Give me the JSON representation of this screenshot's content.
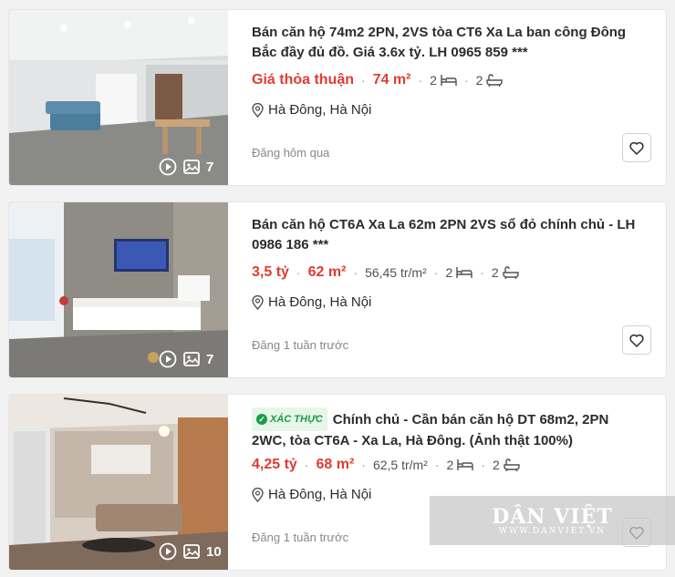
{
  "listings": [
    {
      "title": "Bán căn hộ 74m2 2PN, 2VS tòa CT6 Xa La ban công Đông Bắc đầy đủ đồ. Giá 3.6x tỷ. LH 0965 859 ***",
      "verified": false,
      "badge": "",
      "price": "Giá thỏa thuận",
      "area": "74 m²",
      "price_per_m2": "",
      "bedrooms": "2",
      "bathrooms": "2",
      "location": "Hà Đông, Hà Nội",
      "posted": "Đăng hôm qua",
      "photo_count": "7"
    },
    {
      "title": "Bán căn hộ CT6A Xa La 62m 2PN 2VS sổ đỏ chính chủ - LH 0986 186 ***",
      "verified": false,
      "badge": "",
      "price": "3,5 tỷ",
      "area": "62 m²",
      "price_per_m2": "56,45 tr/m²",
      "bedrooms": "2",
      "bathrooms": "2",
      "location": "Hà Đông, Hà Nội",
      "posted": "Đăng 1 tuần trước",
      "photo_count": "7"
    },
    {
      "title": "Chính chủ - Cần bán căn hộ DT 68m2, 2PN 2WC, tòa CT6A - Xa La, Hà Đông. (Ảnh thật 100%)",
      "verified": true,
      "badge": "XÁC THỰC",
      "price": "4,25 tỷ",
      "area": "68 m²",
      "price_per_m2": "62,5 tr/m²",
      "bedrooms": "2",
      "bathrooms": "2",
      "location": "Hà Đông, Hà Nội",
      "posted": "Đăng 1 tuần trước",
      "photo_count": "10"
    }
  ],
  "watermark": {
    "logo": "DÂN VIỆT",
    "url": "WWW.DANVIET.VN"
  },
  "colors": {
    "price": "#e03c31",
    "verified": "#1e9b46"
  },
  "icons": [
    "play-icon",
    "image-icon",
    "bed-icon",
    "bath-icon",
    "location-pin-icon",
    "heart-icon"
  ]
}
